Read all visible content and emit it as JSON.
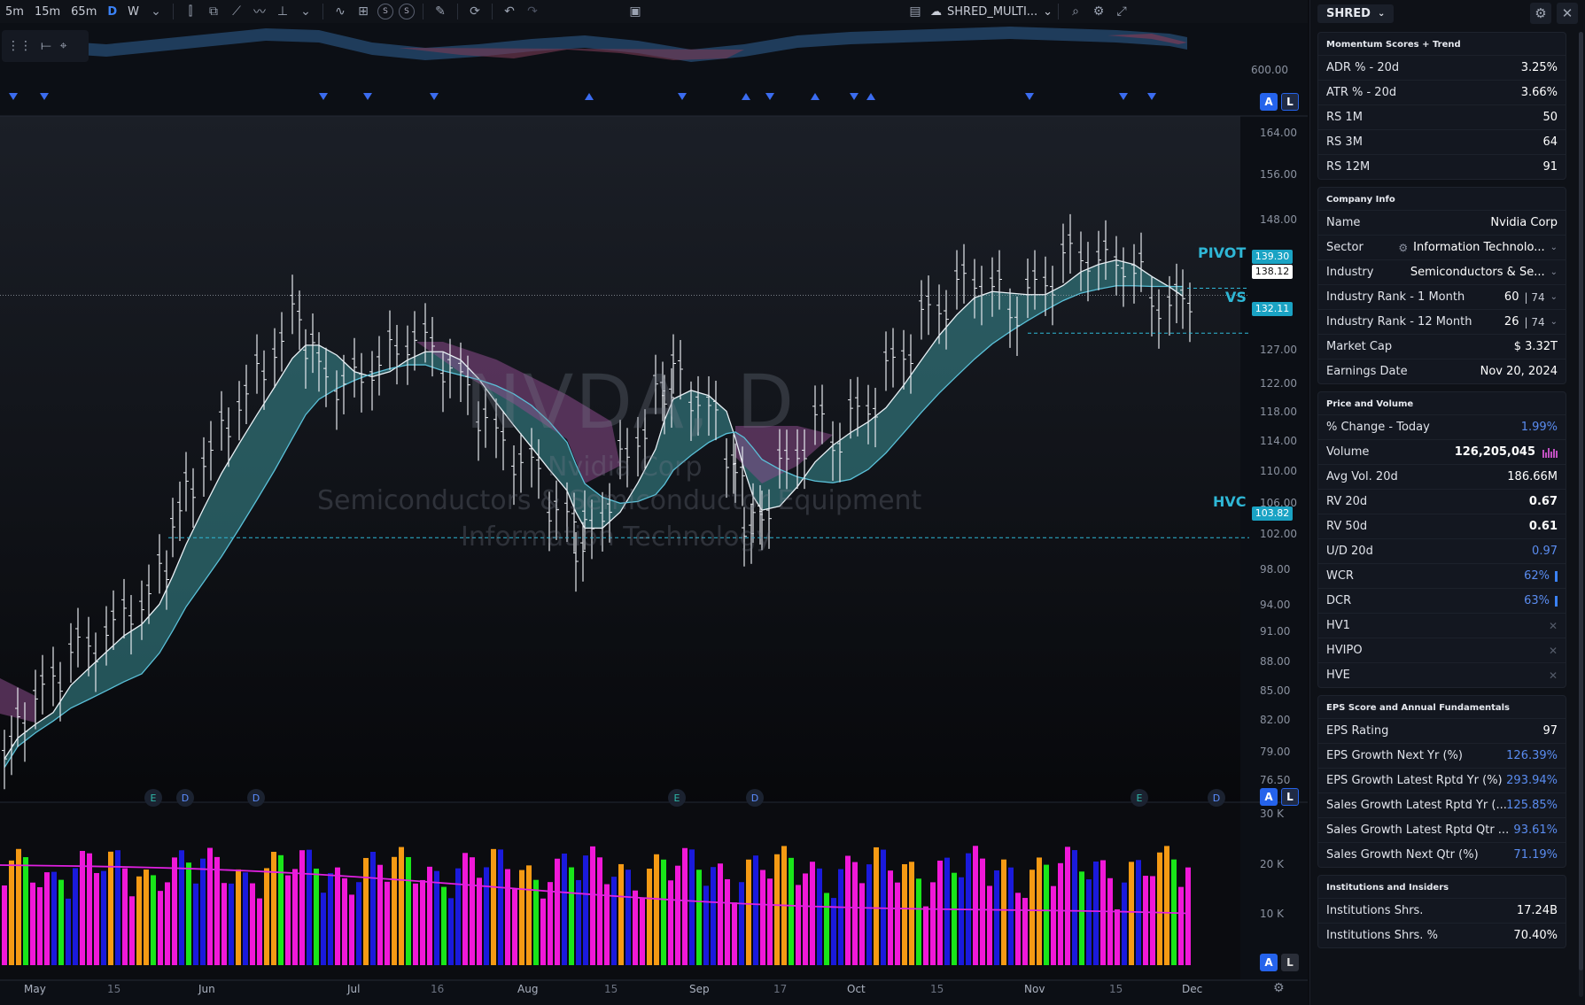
{
  "toolbar": {
    "timeframes": [
      "5m",
      "15m",
      "65m",
      "D",
      "W"
    ],
    "active_timeframe": "D",
    "layout_name": "SHRED_MULTI...",
    "icons": [
      "bar-style-icon",
      "candle-style-icon",
      "line-style-icon",
      "indicators-icon",
      "templates-icon",
      "alert-icon",
      "replay-icon",
      "undo-icon",
      "redo-icon",
      "calendar-icon",
      "layout-icon",
      "search-icon",
      "settings-icon",
      "fullscreen-icon"
    ],
    "circle_buttons": [
      "S",
      "S"
    ]
  },
  "symbol_watermark": {
    "symbol": "NVDA, D",
    "company": "Nvidia Corp",
    "industry": "Semiconductors & Semiconductor Equipment",
    "sector": "Information Technology"
  },
  "top_pane": {
    "axis_label": "600.00"
  },
  "price_axis": [
    "164.00",
    "156.00",
    "148.00",
    "127.00",
    "122.00",
    "118.00",
    "114.00",
    "110.00",
    "106.00",
    "102.00",
    "98.00",
    "94.00",
    "91.00",
    "88.00",
    "85.00",
    "82.00",
    "79.00",
    "76.50"
  ],
  "levels": {
    "pivot": {
      "name": "PIVOT",
      "value": "139.30"
    },
    "last": {
      "value": "138.12"
    },
    "vs": {
      "name": "VS",
      "value": "132.11"
    },
    "hvc": {
      "name": "HVC",
      "value": "103.82"
    }
  },
  "volume_axis": [
    "30 K",
    "20 K",
    "10 K"
  ],
  "ab_buttons": {
    "a": "A",
    "l": "L"
  },
  "events": [
    {
      "type": "E",
      "label": "E"
    },
    {
      "type": "D",
      "label": "D"
    },
    {
      "type": "D",
      "label": "D"
    },
    {
      "type": "E",
      "label": "E"
    },
    {
      "type": "D",
      "label": "D"
    },
    {
      "type": "E",
      "label": "E"
    },
    {
      "type": "D",
      "label": "D"
    }
  ],
  "time_axis": [
    {
      "label": "May",
      "major": true
    },
    {
      "label": "15",
      "major": false
    },
    {
      "label": "Jun",
      "major": true
    },
    {
      "label": "Jul",
      "major": true
    },
    {
      "label": "16",
      "major": false
    },
    {
      "label": "Aug",
      "major": true
    },
    {
      "label": "15",
      "major": false
    },
    {
      "label": "Sep",
      "major": true
    },
    {
      "label": "17",
      "major": false
    },
    {
      "label": "Oct",
      "major": true
    },
    {
      "label": "15",
      "major": false
    },
    {
      "label": "Nov",
      "major": true
    },
    {
      "label": "15",
      "major": false
    },
    {
      "label": "Dec",
      "major": true
    }
  ],
  "colors": {
    "accent": "#2fb7d6",
    "up_band": "#3a8f96",
    "down_band": "#8a4a8a",
    "volume_blue": "#1a1adc",
    "volume_magenta": "#f018d8",
    "volume_orange": "#f59a14",
    "volume_green": "#19e619"
  },
  "panel": {
    "layout_select": "SHRED",
    "sections": [
      {
        "title": "Momentum Scores + Trend",
        "rows": [
          {
            "label": "ADR % - 20d",
            "value": "3.25%"
          },
          {
            "label": "ATR % - 20d",
            "value": "3.66%"
          },
          {
            "label": "RS 1M",
            "value": "50"
          },
          {
            "label": "RS 3M",
            "value": "64"
          },
          {
            "label": "RS 12M",
            "value": "91"
          }
        ]
      },
      {
        "title": "Company Info",
        "rows": [
          {
            "label": "Name",
            "value": "Nvidia Corp"
          },
          {
            "label": "Sector",
            "value": "Information Technolo...",
            "icon": "sector-icon",
            "chevron": true
          },
          {
            "label": "Industry",
            "value": "Semiconductors & Se...",
            "chevron": true
          },
          {
            "label": "Industry Rank - 1 Month",
            "value": "60",
            "suffix": "74",
            "chevron": true
          },
          {
            "label": "Industry Rank - 12 Month",
            "value": "26",
            "suffix": "74",
            "chevron": true
          },
          {
            "label": "Market Cap",
            "value": "$ 3.32T"
          },
          {
            "label": "Earnings Date",
            "value": "Nov 20, 2024"
          }
        ]
      },
      {
        "title": "Price and Volume",
        "rows": [
          {
            "label": "% Change - Today",
            "value": "1.99%",
            "style": "blue"
          },
          {
            "label": "Volume",
            "value": "126,205,045",
            "style": "bold",
            "extra": "volume-bars"
          },
          {
            "label": "Avg Vol. 20d",
            "value": "186.66M"
          },
          {
            "label": "RV 20d",
            "value": "0.67",
            "style": "bold"
          },
          {
            "label": "RV 50d",
            "value": "0.61",
            "style": "bold"
          },
          {
            "label": "U/D 20d",
            "value": "0.97",
            "style": "blue"
          },
          {
            "label": "WCR",
            "value": "62%",
            "style": "blue",
            "extra": "bar"
          },
          {
            "label": "DCR",
            "value": "63%",
            "style": "blue",
            "extra": "bar"
          },
          {
            "label": "HV1",
            "value": "✕",
            "style": "x"
          },
          {
            "label": "HVIPO",
            "value": "✕",
            "style": "x"
          },
          {
            "label": "HVE",
            "value": "✕",
            "style": "x"
          }
        ]
      },
      {
        "title": "EPS Score and Annual Fundamentals",
        "rows": [
          {
            "label": "EPS Rating",
            "value": "97"
          },
          {
            "label": "EPS Growth Next Yr (%)",
            "value": "126.39%",
            "style": "blue"
          },
          {
            "label": "EPS Growth Latest Rptd Yr (%)",
            "value": "293.94%",
            "style": "blue"
          },
          {
            "label": "Sales Growth Latest Rptd Yr (...",
            "value": "125.85%",
            "style": "blue"
          },
          {
            "label": "Sales Growth Latest Rptd Qtr ...",
            "value": "93.61%",
            "style": "blue"
          },
          {
            "label": "Sales Growth Next Qtr (%)",
            "value": "71.19%",
            "style": "blue"
          }
        ]
      },
      {
        "title": "Institutions and Insiders",
        "rows": [
          {
            "label": "Institutions Shrs.",
            "value": "17.24B"
          },
          {
            "label": "Institutions Shrs. %",
            "value": "70.40%"
          }
        ]
      }
    ]
  }
}
